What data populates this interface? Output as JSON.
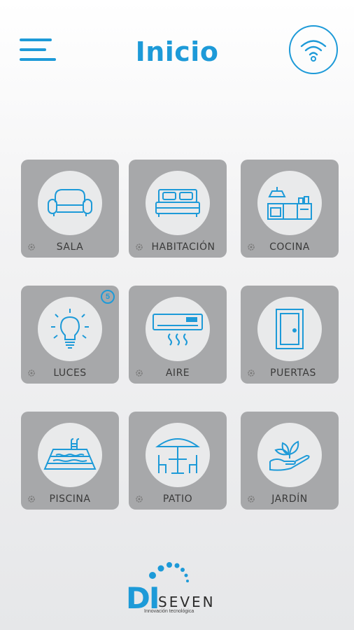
{
  "header": {
    "title": "Inicio"
  },
  "colors": {
    "accent": "#1d9ad8",
    "tile_bg": "#a7a8aa",
    "circle_bg": "#e9eaeb",
    "label_text": "#3a3a3a"
  },
  "rooms": [
    {
      "label": "SALA",
      "icon": "sofa-icon"
    },
    {
      "label": "HABITACIÓN",
      "icon": "bed-icon"
    },
    {
      "label": "COCINA",
      "icon": "kitchen-icon"
    },
    {
      "label": "LUCES",
      "icon": "lightbulb-icon",
      "badge": "5"
    },
    {
      "label": "AIRE",
      "icon": "air-conditioner-icon"
    },
    {
      "label": "PUERTAS",
      "icon": "door-icon"
    },
    {
      "label": "PISCINA",
      "icon": "pool-icon"
    },
    {
      "label": "PATIO",
      "icon": "patio-icon"
    },
    {
      "label": "JARDÍN",
      "icon": "garden-icon"
    }
  ],
  "footer": {
    "logo_di": "DI",
    "logo_seven": "SEVEN",
    "tagline": "Innovación tecnológica"
  }
}
